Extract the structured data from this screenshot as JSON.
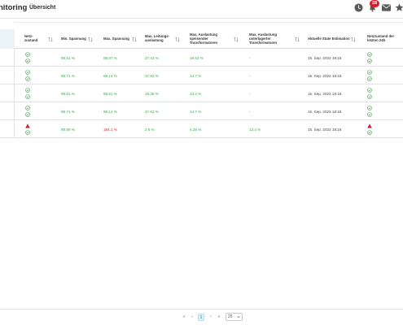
{
  "header": {
    "app_title": "nitoring",
    "tab_overview": "Übersicht",
    "notification_count": "28"
  },
  "table": {
    "columns": [
      "Netz-zustand",
      "Min. Spannung",
      "Max. Spannung",
      "Max. Leitungs-auslastung",
      "Max. Auslastung speisender Transformatoren",
      "Max. Auslastung unterlagerter Transformatoren",
      "Aktuelle State Estimation",
      "Netzzustand der letzten 24h"
    ],
    "rows": [
      {
        "status": [
          "ok",
          "ok"
        ],
        "min_v": "99.51 %",
        "max_v": "99.97 %",
        "max_line": "27.43 %",
        "max_feed": "18.53 %",
        "max_sub": "-",
        "estimation": "15. Sep. 2023 18:18",
        "last24": [
          "ok",
          "ok"
        ],
        "max_v_alert": false
      },
      {
        "status": [
          "ok",
          "ok"
        ],
        "min_v": "98.71 %",
        "max_v": "99.14 %",
        "max_line": "37.62 %",
        "max_feed": "14.7 %",
        "max_sub": "-",
        "estimation": "15. Sep. 2023 18:18",
        "last24": [
          "ok",
          "ok"
        ],
        "max_v_alert": false
      },
      {
        "status": [
          "ok",
          "ok"
        ],
        "min_v": "99.51 %",
        "max_v": "99.51 %",
        "max_line": "19.38 %",
        "max_feed": "13.2 %",
        "max_sub": "-",
        "estimation": "15. Sep. 2023 18:18",
        "last24": [
          "ok",
          "ok"
        ],
        "max_v_alert": false
      },
      {
        "status": [
          "ok",
          "ok"
        ],
        "min_v": "98.71 %",
        "max_v": "99.14 %",
        "max_line": "37.62 %",
        "max_feed": "14.7 %",
        "max_sub": "-",
        "estimation": "15. Sep. 2023 18:18",
        "last24": [
          "ok",
          "ok"
        ],
        "max_v_alert": false
      },
      {
        "status": [
          "warn",
          "ok"
        ],
        "min_v": "89.89 %",
        "max_v": "184.1 %",
        "max_line": "2.8 %",
        "max_feed": "4.28 %",
        "max_sub": "13.4 %",
        "estimation": "15. Sep. 2023 18:18",
        "last24": [
          "warn",
          "ok"
        ],
        "max_v_alert": true
      }
    ]
  },
  "pagination": {
    "first": "«",
    "prev": "‹",
    "current_page": "1",
    "next": "›",
    "last": "»",
    "page_size": "25"
  },
  "colors": {
    "ok": "#3fa34d",
    "alert": "#c8252e",
    "badge": "#e11b2a",
    "header_highlight": "#eaf4f8"
  },
  "icons": {
    "clock": "clock-icon",
    "bell": "bell-icon",
    "mail": "mail-icon",
    "star": "star-icon",
    "sort": "sort-icon",
    "ok": "check-circle-icon",
    "warn": "warning-triangle-icon"
  }
}
